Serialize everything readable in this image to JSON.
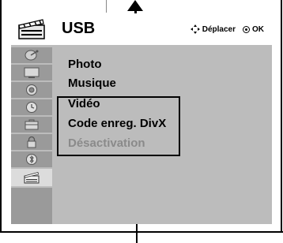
{
  "menu": {
    "title": "USB",
    "hint_move": "Déplacer",
    "hint_ok": "OK"
  },
  "items": [
    {
      "label": "Photo",
      "state": "normal"
    },
    {
      "label": "Musique",
      "state": "normal"
    },
    {
      "label": "Vidéo",
      "state": "normal"
    },
    {
      "label": "Code enreg. DivX",
      "state": "normal"
    },
    {
      "label": "Désactivation",
      "state": "disabled"
    }
  ],
  "sidebar_icons": [
    "satellite-dish-icon",
    "screen-icon",
    "speaker-icon",
    "clock-icon",
    "toolbox-icon",
    "lock-icon",
    "bluetooth-icon",
    "usb-clapperboard-icon"
  ],
  "active_sidebar_index": 7,
  "colors": {
    "panel_bg": "#bcbcbc",
    "sidebar_bg": "#9a9a9a",
    "disabled_text": "#8a8a8a"
  }
}
